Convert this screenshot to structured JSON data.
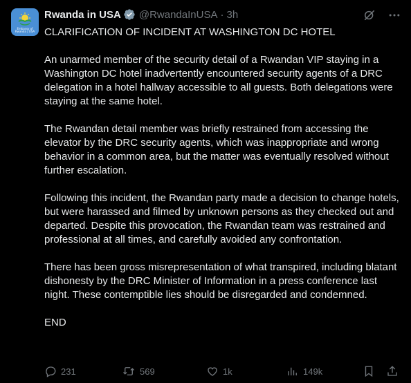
{
  "account": {
    "name": "Rwanda in USA",
    "handle": "@RwandaInUSA",
    "separator": "·",
    "time": "3h",
    "avatar_text": [
      "Embassy of",
      "Rwanda | USA"
    ]
  },
  "tweet": {
    "title": "CLARIFICATION OF INCIDENT AT WASHINGTON DC HOTEL",
    "paragraphs": [
      "An unarmed member of the security detail of a Rwandan VIP staying in a Washington DC hotel inadvertently encountered security agents of a DRC delegation in a hotel hallway accessible to all guests. Both delegations were staying at the same hotel.",
      "The Rwandan detail member was briefly restrained from accessing the elevator by the DRC security agents, which was inappropriate and wrong behavior in a common area, but the matter was eventually resolved without further escalation.",
      "Following this incident, the Rwandan party made a decision to change hotels, but were harassed and filmed by unknown persons as they checked out and departed. Despite this provocation, the Rwandan team was restrained and professional at all times, and carefully avoided any confrontation.",
      "There has been gross misrepresentation of what transpired, including blatant dishonesty by the DRC Minister of Information in a press conference last night. These contemptible lies should be disregarded and condemned.",
      "END"
    ]
  },
  "actions": {
    "replies": "231",
    "reposts": "569",
    "likes": "1k",
    "views": "149k"
  },
  "icons": {
    "verified": "verified-badge-icon",
    "grok": "grok-icon",
    "more": "more-icon",
    "reply": "reply-icon",
    "repost": "repost-icon",
    "like": "like-icon",
    "views": "views-icon",
    "bookmark": "bookmark-icon",
    "share": "share-icon"
  },
  "colors": {
    "background": "#000000",
    "text": "#e7e9ea",
    "muted": "#71767b",
    "avatar": "#4a8fd6"
  }
}
